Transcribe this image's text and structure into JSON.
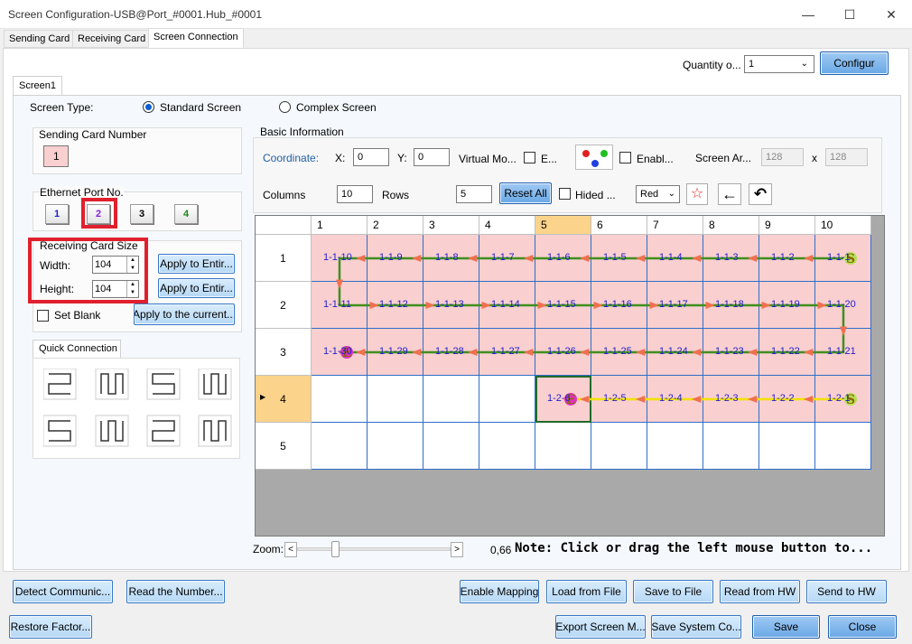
{
  "window": {
    "title": "Screen Configuration-USB@Port_#0001.Hub_#0001",
    "minimize_icon": "minimize-icon",
    "maximize_icon": "maximize-icon",
    "close_icon": "close-icon"
  },
  "tabs": [
    {
      "label": "Sending Card"
    },
    {
      "label": "Receiving Card"
    },
    {
      "label": "Screen Connection"
    }
  ],
  "top": {
    "quantity_label": "Quantity o...",
    "quantity_value": "1",
    "configure_label": "Configur"
  },
  "screen_tab": "Screen1",
  "screen_type": {
    "label": "Screen Type:",
    "standard": "Standard Screen",
    "complex": "Complex Screen",
    "selected": "standard"
  },
  "sending_card": {
    "label": "Sending Card Number",
    "value": "1"
  },
  "ethernet": {
    "label": "Ethernet Port No.",
    "ports": [
      "1",
      "2",
      "3",
      "4"
    ],
    "selected": "2"
  },
  "receiving_size": {
    "label": "Receiving Card Size",
    "width_label": "Width:",
    "width_value": "104",
    "height_label": "Height:",
    "height_value": "104",
    "apply_entire_w": "Apply to Entir...",
    "apply_entire_h": "Apply to Entir...",
    "set_blank": "Set Blank",
    "apply_current": "Apply to the current..."
  },
  "quick_connection": {
    "label": "Quick Connection"
  },
  "basic_info": {
    "label": "Basic Information",
    "coordinate_label": "Coordinate:",
    "x_label": "X:",
    "x_value": "0",
    "y_label": "Y:",
    "y_value": "0",
    "virtual_label": "Virtual Mo...",
    "e_label": "E...",
    "enable_label": "Enabl...",
    "screen_area_label": "Screen Ar...",
    "area_w": "128",
    "area_x": "x",
    "area_h": "128",
    "columns_label": "Columns",
    "columns_value": "10",
    "rows_label": "Rows",
    "rows_value": "5",
    "reset_all": "Reset All",
    "hided_label": "Hided ...",
    "color_value": "Red"
  },
  "grid": {
    "col_headers": [
      "1",
      "2",
      "3",
      "4",
      "5",
      "6",
      "7",
      "8",
      "9",
      "10"
    ],
    "row_headers": [
      "1",
      "2",
      "3",
      "4",
      "5"
    ],
    "selected_col": "5",
    "selected_row": "4",
    "rows": [
      [
        "1-1-10",
        "1-1-9",
        "1-1-8",
        "1-1-7",
        "1-1-6",
        "1-1-5",
        "1-1-4",
        "1-1-3",
        "1-1-2",
        "1-1-1"
      ],
      [
        "1-1-11",
        "1-1-12",
        "1-1-13",
        "1-1-14",
        "1-1-15",
        "1-1-16",
        "1-1-17",
        "1-1-18",
        "1-1-19",
        "1-1-20"
      ],
      [
        "1-1-30",
        "1-1-29",
        "1-1-28",
        "1-1-27",
        "1-1-26",
        "1-1-25",
        "1-1-24",
        "1-1-23",
        "1-1-22",
        "1-1-21"
      ],
      [
        "",
        "",
        "",
        "",
        "1-2-6",
        "1-2-5",
        "1-2-4",
        "1-2-3",
        "1-2-2",
        "1-2-1"
      ],
      [
        "",
        "",
        "",
        "",
        "",
        "",
        "",
        "",
        "",
        ""
      ]
    ],
    "start_marker": "S",
    "end_marker": "E"
  },
  "zoom": {
    "label": "Zoom:",
    "left": "<",
    "right": ">",
    "value": "0,66"
  },
  "note": "Note: Click or drag the left mouse button to...",
  "bottom_row1": {
    "detect": "Detect Communic...",
    "read_number": "Read the Number...",
    "enable_mapping": "Enable Mapping",
    "load_file": "Load from File",
    "save_file": "Save to File",
    "read_hw": "Read from HW",
    "send_hw": "Send to HW"
  },
  "bottom_row2": {
    "restore": "Restore Factor...",
    "export": "Export Screen M...",
    "save_system": "Save System Co...",
    "save": "Save",
    "close": "Close"
  },
  "colors": {
    "accent": "#3a78c4",
    "highlight": "#e0202e",
    "cell_pink": "#f9cfcf",
    "route_green": "#3f8f1f",
    "route_yellow": "#f2e200",
    "arrow": "#f07050"
  }
}
